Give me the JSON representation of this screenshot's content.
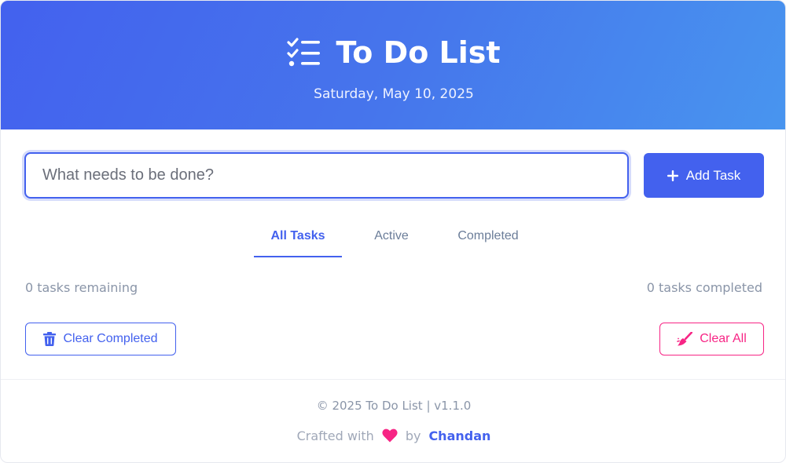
{
  "app": {
    "title": "To Do List",
    "date": "Saturday, May 10, 2025",
    "icon": "checklist-icon"
  },
  "input": {
    "placeholder": "What needs to be done?",
    "value": ""
  },
  "add_button": {
    "label": "Add Task",
    "icon": "plus-icon"
  },
  "tabs": [
    {
      "label": "All Tasks",
      "active": true
    },
    {
      "label": "Active",
      "active": false
    },
    {
      "label": "Completed",
      "active": false
    }
  ],
  "stats": {
    "remaining": "0 tasks remaining",
    "completed": "0 tasks completed"
  },
  "actions": {
    "clear_completed": {
      "label": "Clear Completed",
      "icon": "trash-icon"
    },
    "clear_all": {
      "label": "Clear All",
      "icon": "broom-icon"
    }
  },
  "footer": {
    "copyright": "© 2025 To Do List | v1.1.0",
    "crafted_with": "Crafted with",
    "heart_icon": "heart-icon",
    "by": "by",
    "author": "Chandan"
  },
  "colors": {
    "primary": "#4361ee",
    "header_gradient_end": "#4895ef",
    "danger": "#f72585",
    "muted": "#8a95a8"
  }
}
